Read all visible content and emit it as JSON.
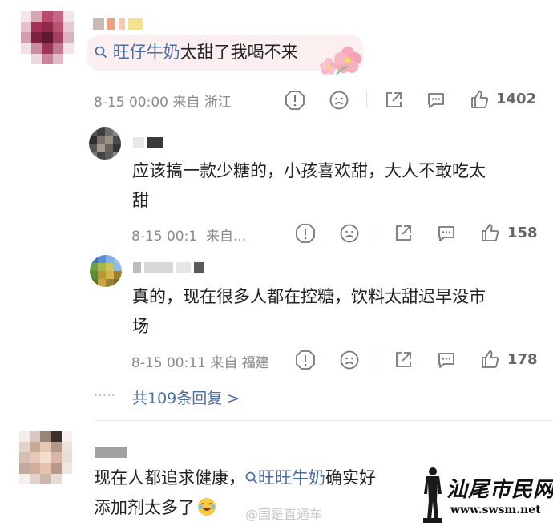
{
  "top_comment": {
    "topic_link": "旺仔牛奶",
    "text_after": "太甜了我喝不来",
    "meta": "8-15 00:00 来自 浙江",
    "likes": "1402"
  },
  "replies": [
    {
      "text": "应该搞一款少糖的，小孩喜欢甜，大人不敢吃太甜",
      "line1": "应该搞一款少糖的，小孩喜欢甜，大人不敢吃太",
      "line2": "甜",
      "meta": "8-15 00:1  来自...",
      "likes": "158"
    },
    {
      "line1": "真的，现在很多人都在控糖，饮料太甜迟早没市",
      "line2": "场",
      "meta": "8-15 00:11 来自 福建",
      "likes": "178"
    }
  ],
  "more_replies": {
    "dots": "·····",
    "label": "共109条回复 >"
  },
  "second_comment": {
    "text_before": "现在人都追求健康，",
    "topic_link": "旺旺牛奶",
    "text_after": "确实好",
    "line2": "添加剂太多了",
    "emoji": "laughing-crying-emoji"
  },
  "watermarks": {
    "weibo": "@国是直通车",
    "site_name": "汕尾市民网",
    "site_url": "www.swsm.net"
  },
  "colors": {
    "link": "#4a6fa5",
    "meta": "#8a8a8a",
    "highlight_bg": "#fbf0ef"
  }
}
